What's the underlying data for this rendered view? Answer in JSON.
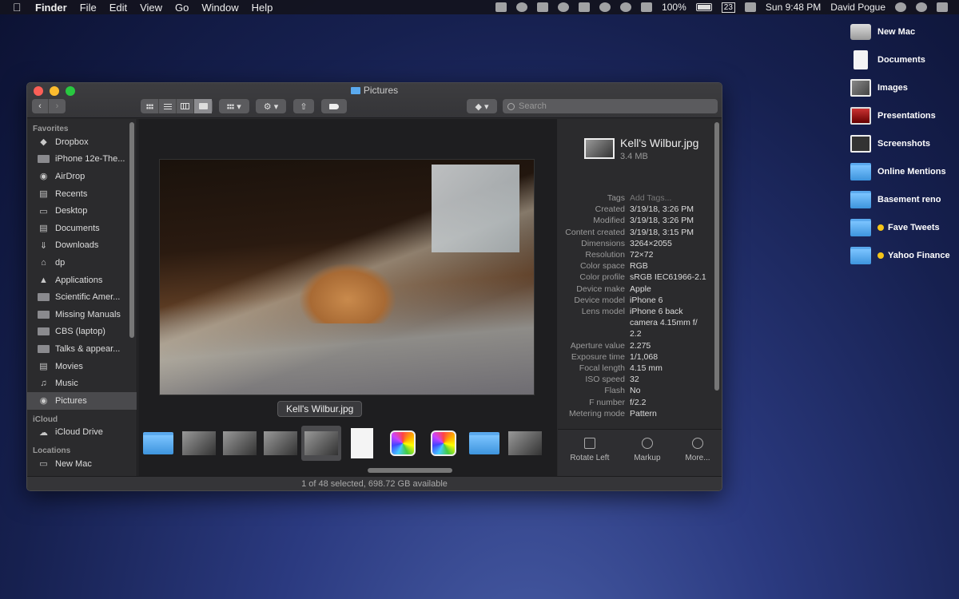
{
  "menubar": {
    "app": "Finder",
    "items": [
      "File",
      "Edit",
      "View",
      "Go",
      "Window",
      "Help"
    ],
    "battery": "100%",
    "date_badge": "23",
    "clock": "Sun 9:48 PM",
    "user": "David Pogue"
  },
  "desktop": [
    {
      "label": "New Mac",
      "icon": "drive-icon",
      "tag": false
    },
    {
      "label": "Documents",
      "icon": "document-icon",
      "tag": false
    },
    {
      "label": "Images",
      "icon": "image-icon",
      "tag": false
    },
    {
      "label": "Presentations",
      "icon": "presentation-icon",
      "tag": false
    },
    {
      "label": "Screenshots",
      "icon": "screenshot-icon",
      "tag": false
    },
    {
      "label": "Online Mentions",
      "icon": "folder-icon",
      "tag": false
    },
    {
      "label": "Basement reno",
      "icon": "folder-icon",
      "tag": false
    },
    {
      "label": "Fave Tweets",
      "icon": "folder-icon",
      "tag": true
    },
    {
      "label": "Yahoo Finance",
      "icon": "folder-icon",
      "tag": true
    }
  ],
  "window": {
    "title": "Pictures",
    "search_placeholder": "Search",
    "status": "1 of 48 selected, 698.72 GB available",
    "tooltip": "Kell's Wilbur.jpg"
  },
  "sidebar": {
    "favorites_header": "Favorites",
    "favorites": [
      {
        "label": "Dropbox",
        "icon": "dropbox-icon"
      },
      {
        "label": "iPhone 12e-The...",
        "icon": "folder-icon"
      },
      {
        "label": "AirDrop",
        "icon": "airdrop-icon"
      },
      {
        "label": "Recents",
        "icon": "recents-icon"
      },
      {
        "label": "Desktop",
        "icon": "desktop-icon"
      },
      {
        "label": "Documents",
        "icon": "documents-icon"
      },
      {
        "label": "Downloads",
        "icon": "downloads-icon"
      },
      {
        "label": "dp",
        "icon": "home-icon"
      },
      {
        "label": "Applications",
        "icon": "applications-icon"
      },
      {
        "label": "Scientific Amer...",
        "icon": "folder-icon"
      },
      {
        "label": "Missing Manuals",
        "icon": "folder-icon"
      },
      {
        "label": "CBS (laptop)",
        "icon": "folder-icon"
      },
      {
        "label": "Talks & appear...",
        "icon": "folder-icon"
      },
      {
        "label": "Movies",
        "icon": "movies-icon"
      },
      {
        "label": "Music",
        "icon": "music-icon"
      },
      {
        "label": "Pictures",
        "icon": "pictures-icon",
        "selected": true
      }
    ],
    "icloud_header": "iCloud",
    "icloud": [
      {
        "label": "iCloud Drive",
        "icon": "cloud-icon"
      }
    ],
    "locations_header": "Locations",
    "locations": [
      {
        "label": "New Mac",
        "icon": "drive-icon"
      }
    ]
  },
  "inspector": {
    "name": "Kell's Wilbur.jpg",
    "size": "3.4 MB",
    "metadata": [
      {
        "k": "Tags",
        "v": "Add Tags...",
        "placeholder": true
      },
      {
        "k": "Created",
        "v": "3/19/18, 3:26 PM"
      },
      {
        "k": "Modified",
        "v": "3/19/18, 3:26 PM"
      },
      {
        "k": "Content created",
        "v": "3/19/18, 3:15 PM"
      },
      {
        "k": "Dimensions",
        "v": "3264×2055"
      },
      {
        "k": "Resolution",
        "v": "72×72"
      },
      {
        "k": "Color space",
        "v": "RGB"
      },
      {
        "k": "Color profile",
        "v": "sRGB IEC61966-2.1"
      },
      {
        "k": "Device make",
        "v": "Apple"
      },
      {
        "k": "Device model",
        "v": "iPhone 6"
      },
      {
        "k": "Lens model",
        "v": "iPhone 6 back camera 4.15mm f/ 2.2"
      },
      {
        "k": "Aperture value",
        "v": "2.275"
      },
      {
        "k": "Exposure time",
        "v": "1/1,068"
      },
      {
        "k": "Focal length",
        "v": "4.15 mm"
      },
      {
        "k": "ISO speed",
        "v": "32"
      },
      {
        "k": "Flash",
        "v": "No"
      },
      {
        "k": "F number",
        "v": "f/2.2"
      },
      {
        "k": "Metering mode",
        "v": "Pattern"
      }
    ],
    "actions": [
      {
        "label": "Rotate Left",
        "icon": "rotate-left-icon"
      },
      {
        "label": "Markup",
        "icon": "markup-icon"
      },
      {
        "label": "More...",
        "icon": "more-icon"
      }
    ]
  },
  "thumbnails": [
    {
      "kind": "folder"
    },
    {
      "kind": "img"
    },
    {
      "kind": "img"
    },
    {
      "kind": "img"
    },
    {
      "kind": "img",
      "selected": true
    },
    {
      "kind": "doc"
    },
    {
      "kind": "photos"
    },
    {
      "kind": "photos"
    },
    {
      "kind": "folder"
    },
    {
      "kind": "img"
    }
  ]
}
